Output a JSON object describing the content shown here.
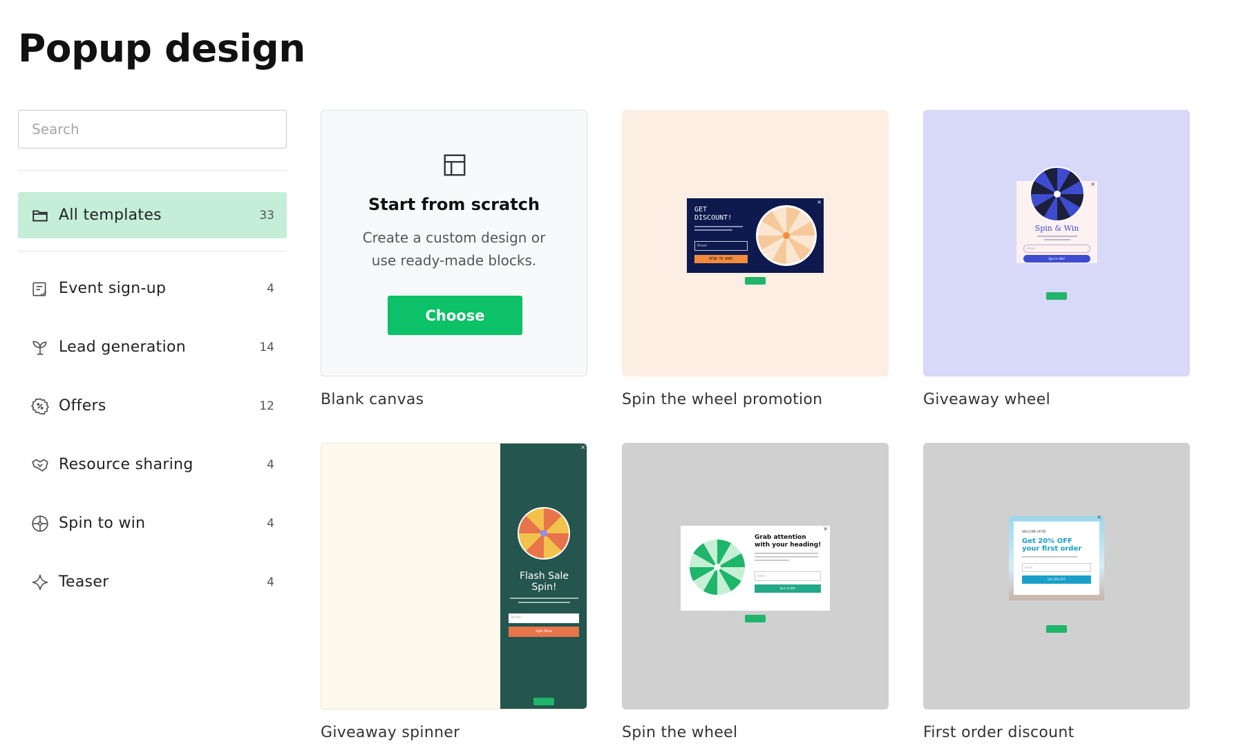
{
  "page": {
    "title": "Popup design"
  },
  "search": {
    "placeholder": "Search"
  },
  "sidebar": {
    "all": {
      "label": "All templates",
      "count": "33"
    },
    "items": [
      {
        "label": "Event sign-up",
        "count": "4",
        "icon": "calendar-check-icon"
      },
      {
        "label": "Lead generation",
        "count": "14",
        "icon": "seedling-icon"
      },
      {
        "label": "Offers",
        "count": "12",
        "icon": "discount-badge-icon"
      },
      {
        "label": "Resource sharing",
        "count": "4",
        "icon": "handshake-icon"
      },
      {
        "label": "Spin to win",
        "count": "4",
        "icon": "wheel-icon"
      },
      {
        "label": "Teaser",
        "count": "4",
        "icon": "sparkle-icon"
      }
    ]
  },
  "templates": [
    {
      "title": "Blank canvas",
      "heading": "Start from scratch",
      "description": "Create a custom design or use ready-made blocks.",
      "button": "Choose"
    },
    {
      "title": "Spin the wheel promotion",
      "preview": {
        "heading_line1": "GET",
        "heading_line2": "DISCOUNT!",
        "cta": "SPIN TO WIN!",
        "input": "Email",
        "background": "#fdeee4"
      }
    },
    {
      "title": "Giveaway wheel",
      "preview": {
        "heading": "Spin & Win",
        "input": "Email",
        "cta": "Spin to Win!",
        "background": "#d8d9f8"
      }
    },
    {
      "title": "Giveaway spinner",
      "preview": {
        "heading_line1": "Flash Sale",
        "heading_line2": "Spin!",
        "input": "Email",
        "cta": "Spin Now",
        "background": "#fdf9ec"
      }
    },
    {
      "title": "Spin the wheel",
      "preview": {
        "heading_line1": "Grab attention",
        "heading_line2": "with your heading!",
        "input": "Email",
        "cta": "Spin to Win",
        "background": "#d0d0d0"
      }
    },
    {
      "title": "First order discount",
      "preview": {
        "kicker": "WELCOME OFFER",
        "heading_line1": "Get 20% OFF",
        "heading_line2": "your first order",
        "input": "Email",
        "cta": "Get 20% OFF",
        "background": "#d0d0d0"
      }
    }
  ]
}
